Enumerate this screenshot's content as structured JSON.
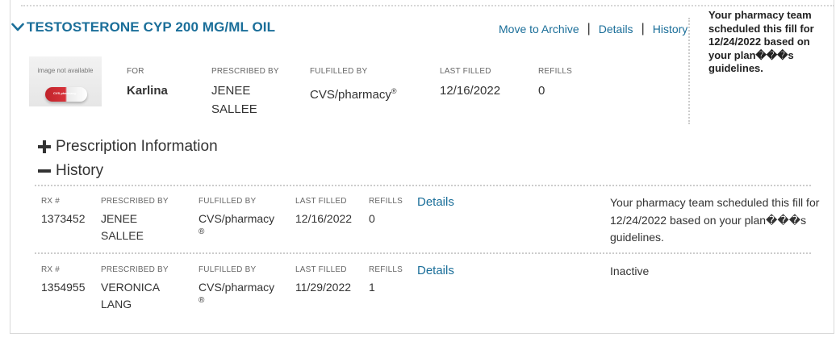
{
  "prescription": {
    "drug_name": "TESTOSTERONE CYP 200 MG/ML OIL",
    "links": {
      "archive": "Move to Archive",
      "details": "Details",
      "history": "History"
    },
    "side_note": "Your pharmacy team scheduled this fill for 12/24/2022 based on your plan���s guidelines.",
    "image_placeholder": "image not available",
    "image_brand_text": "CVS pharmacy",
    "for_label": "FOR",
    "for_value": "Karlina",
    "prescribed_by_label": "PRESCRIBED BY",
    "prescribed_by_value": "JENEE SALLEE",
    "fulfilled_by_label": "FULFILLED BY",
    "fulfilled_by_value": "CVS/pharmacy",
    "registered_mark": "®",
    "last_filled_label": "LAST FILLED",
    "last_filled_value": "12/16/2022",
    "refills_label": "REFILLS",
    "refills_value": "0"
  },
  "sections": {
    "prescription_info": "Prescription Information",
    "history": "History"
  },
  "history": {
    "labels": {
      "rx": "RX #",
      "prescribed_by": "PRESCRIBED BY",
      "fulfilled_by": "FULFILLED BY",
      "last_filled": "LAST FILLED",
      "refills": "REFILLS"
    },
    "rows": [
      {
        "rx": "1373452",
        "prescribed_by": "JENEE SALLEE",
        "fulfilled_by": "CVS/pharmacy",
        "reg": "®",
        "last_filled": "12/16/2022",
        "refills": "0",
        "details": "Details",
        "note": "Your pharmacy team scheduled this fill for 12/24/2022 based on your plan���s guidelines."
      },
      {
        "rx": "1354955",
        "prescribed_by": "VERONICA LANG",
        "fulfilled_by": "CVS/pharmacy",
        "reg": "®",
        "last_filled": "11/29/2022",
        "refills": "1",
        "details": "Details",
        "note": "Inactive"
      }
    ]
  },
  "colors": {
    "link": "#1a6e99",
    "text": "#333333",
    "label": "#666666"
  },
  "icons": {
    "collapse": "chevron-down-icon",
    "expand": "plus-icon",
    "collapse_section": "minus-icon"
  }
}
